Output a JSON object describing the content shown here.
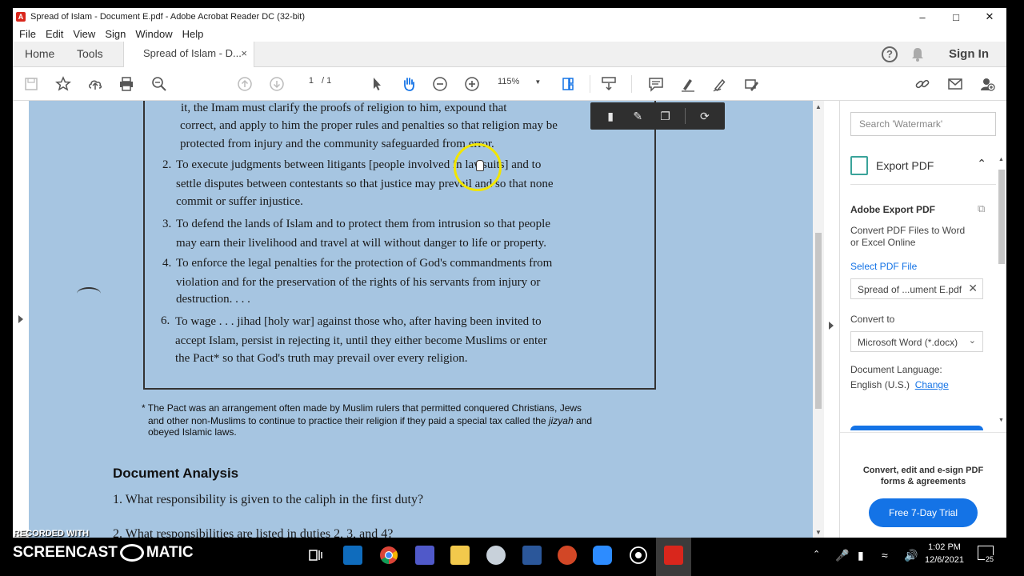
{
  "window": {
    "title": "Spread of Islam - Document E.pdf - Adobe Acrobat Reader DC (32-bit)",
    "minimize": "–",
    "maximize": "□",
    "close": "✕"
  },
  "menu": [
    "File",
    "Edit",
    "View",
    "Sign",
    "Window",
    "Help"
  ],
  "tabs": {
    "home": "Home",
    "tools": "Tools",
    "doc": "Spread of Islam - D...",
    "close": "×",
    "help": "?",
    "signin": "Sign In"
  },
  "toolbar": {
    "page_current": "1",
    "page_sep": "/",
    "page_total": "1",
    "zoom": "115%"
  },
  "document": {
    "top_lines": [
      "it, the Imam must clarify the proofs of religion to him, expound that",
      "correct, and apply to him the proper rules and penalties so that religion may be",
      "protected from injury and the community safeguarded from error."
    ],
    "items": [
      {
        "num": "2.",
        "lines": [
          "To execute judgments between litigants [people involved in lawsuits] and to",
          "settle disputes between contestants so that justice may prevail and so that none",
          "commit or suffer injustice."
        ]
      },
      {
        "num": "3.",
        "lines": [
          "To defend the lands of Islam and to protect them from intrusion so that people",
          "may earn their livelihood and travel at will without danger to life or property."
        ]
      },
      {
        "num": "4.",
        "lines": [
          "To enforce the legal penalties for the protection of God's commandments from",
          "violation and for the preservation of the rights of his servants from injury or",
          "destruction. . . ."
        ]
      },
      {
        "num": "6.",
        "lines": [
          "To wage . . . jihad [holy war] against those who, after having been invited to",
          "accept Islam, persist in rejecting it, until they either become Muslims or enter",
          "the Pact* so that God's truth may prevail over every religion."
        ]
      }
    ],
    "footnote": [
      "* The Pact was an arrangement often made by Muslim rulers that permitted conquered Christians, Jews",
      "and other non-Muslims to continue to practice their religion if they paid a special tax called the",
      "jizyah",
      "and",
      "obeyed Islamic laws."
    ],
    "analysis_heading": "Document Analysis",
    "questions": [
      "1. What responsibility is given to the caliph in the first duty?",
      "2. What responsibilities are listed in duties 2, 3, and 4?"
    ]
  },
  "right_pane": {
    "search_placeholder": "Search 'Watermark'",
    "export_label": "Export PDF",
    "export_chev": "⌃",
    "title": "Adobe Export PDF",
    "desc_1": "Convert PDF Files to Word",
    "desc_2": "or Excel Online",
    "select_file": "Select PDF File",
    "file_name": "Spread of ...ument E.pdf",
    "convert_to": "Convert to",
    "format": "Microsoft Word (*.docx)",
    "language_label": "Document Language:",
    "language": "English (U.S.)",
    "change": "Change",
    "promo_1": "Convert, edit and e-sign PDF",
    "promo_2": "forms & agreements",
    "trial_button": "Free 7-Day Trial"
  },
  "taskbar": {
    "time": "1:02 PM",
    "date": "12/6/2021",
    "notif_count": "25"
  },
  "watermark": {
    "line1": "RECORDED WITH",
    "line2": "SCREENCAST",
    "line3": "MATIC"
  },
  "colors": {
    "doc_bg": "#a6c5e1",
    "accent": "#1473e6",
    "cursor_ring": "#f2e600",
    "acrobat_red": "#d9261c"
  }
}
